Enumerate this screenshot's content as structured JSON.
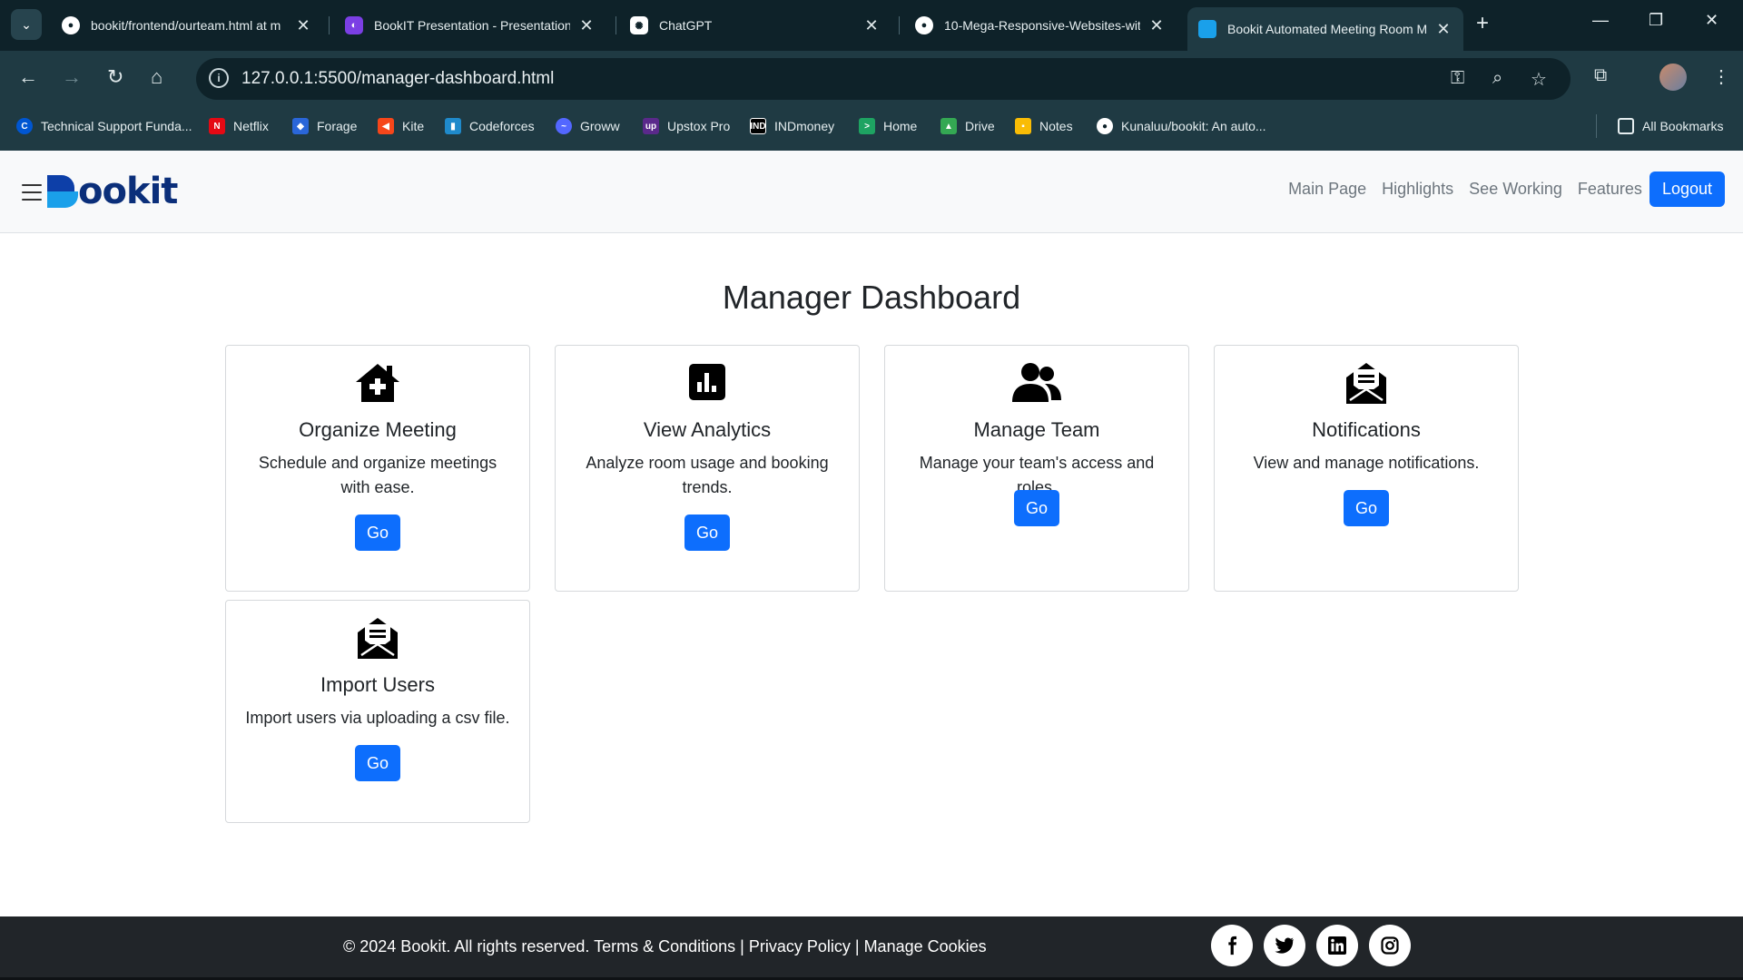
{
  "browser": {
    "tabs": [
      {
        "title": "bookit/frontend/ourteam.html at m",
        "icon": "github-icon"
      },
      {
        "title": "BookIT Presentation - Presentation",
        "icon": "canva-icon"
      },
      {
        "title": "ChatGPT",
        "icon": "chatgpt-icon"
      },
      {
        "title": "10-Mega-Responsive-Websites-wit",
        "icon": "github-icon"
      },
      {
        "title": "Bookit Automated Meeting Room M",
        "icon": "bookit-icon",
        "active": true
      }
    ],
    "url": "127.0.0.1:5500/manager-dashboard.html",
    "bookmarks": [
      {
        "label": "Technical Support Funda...",
        "icon": "coursera-icon"
      },
      {
        "label": "Netflix",
        "icon": "netflix-icon"
      },
      {
        "label": "Forage",
        "icon": "forage-icon"
      },
      {
        "label": "Kite",
        "icon": "kite-icon"
      },
      {
        "label": "Codeforces",
        "icon": "codeforces-icon"
      },
      {
        "label": "Groww",
        "icon": "groww-icon"
      },
      {
        "label": "Upstox Pro",
        "icon": "upstox-icon"
      },
      {
        "label": "INDmoney",
        "icon": "indmoney-icon"
      },
      {
        "label": "Home",
        "icon": "home-icon"
      },
      {
        "label": "Drive",
        "icon": "drive-icon"
      },
      {
        "label": "Notes",
        "icon": "notes-icon"
      },
      {
        "label": "Kunaluu/bookit: An auto...",
        "icon": "github-icon"
      }
    ],
    "all_bookmarks": "All Bookmarks"
  },
  "site": {
    "brand": "ookit",
    "nav_links": [
      "Main Page",
      "Highlights",
      "See Working",
      "Features"
    ],
    "logout_label": "Logout",
    "accent_color": "#0d6efd"
  },
  "dashboard": {
    "title": "Manager Dashboard",
    "cards": [
      {
        "title": "Organize Meeting",
        "description": "Schedule and organize meetings with ease.",
        "button": "Go",
        "icon": "house-plus-icon"
      },
      {
        "title": "View Analytics",
        "description": "Analyze room usage and booking trends.",
        "button": "Go",
        "icon": "bar-chart-icon"
      },
      {
        "title": "Manage Team",
        "description": "Manage your team's access and roles.",
        "button": "Go",
        "icon": "users-icon"
      },
      {
        "title": "Notifications",
        "description": "View and manage notifications.",
        "button": "Go",
        "icon": "envelope-open-icon"
      },
      {
        "title": "Import Users",
        "description": "Import users via uploading a csv file.",
        "button": "Go",
        "icon": "envelope-open-icon"
      }
    ]
  },
  "footer": {
    "copyright": "© 2024 Bookit. All rights reserved.",
    "links": [
      "Terms & Conditions",
      "Privacy Policy",
      "Manage Cookies"
    ],
    "social": [
      "facebook-icon",
      "twitter-icon",
      "linkedin-icon",
      "instagram-icon"
    ]
  }
}
